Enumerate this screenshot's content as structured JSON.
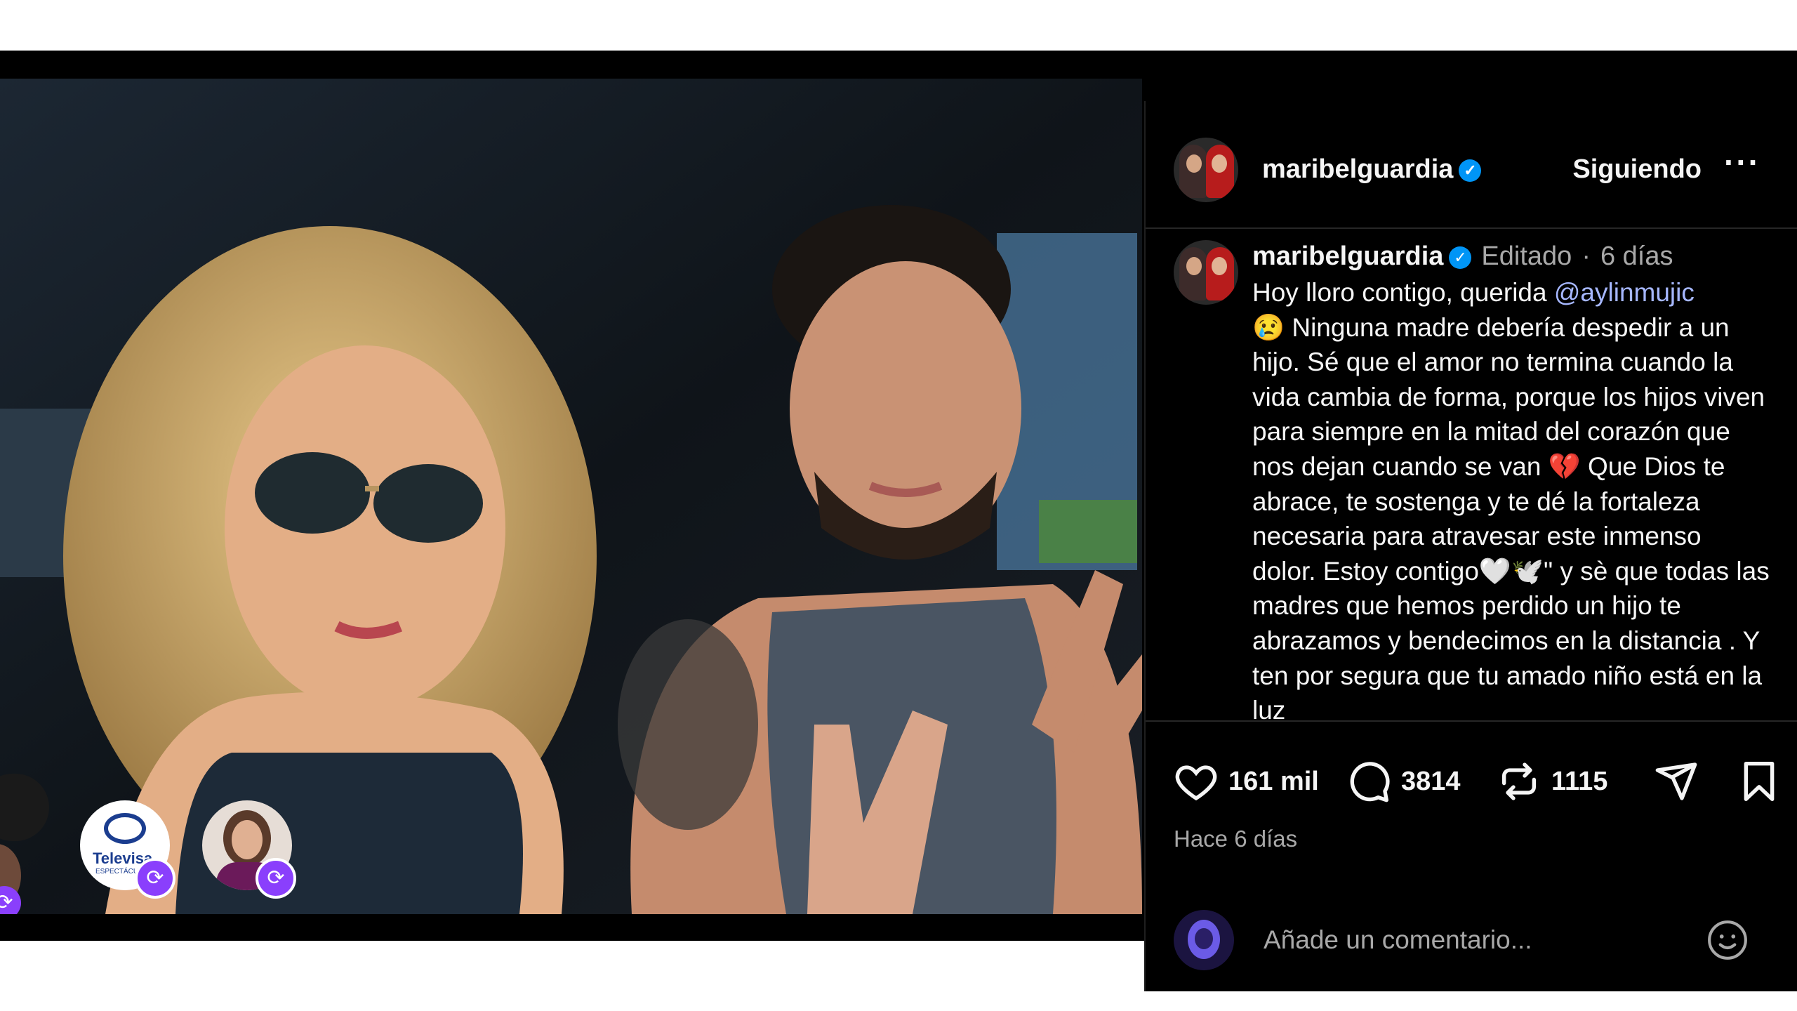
{
  "post": {
    "username": "maribelguardia",
    "verified_icon": "verified-badge-icon",
    "follow_label": "Siguiendo",
    "more_label": "···"
  },
  "caption": {
    "username": "maribelguardia",
    "edited": "Editado",
    "separator": "·",
    "age": "6 días",
    "text_before_mention": "Hoy lloro contigo, querida ",
    "mention": "@aylinmujic",
    "text_after_mention": "\n😢 Ninguna madre debería despedir a un hijo. Sé que el amor no termina cuando la vida cambia de forma, porque los hijos viven para siempre en la mitad del corazón que nos dejan cuando se van 💔 Que Dios te abrace, te sostenga y te dé la fortaleza necesaria para atravesar este inmenso dolor. Estoy contigo🤍🕊️\" y sè que todas las madres que hemos perdido un hijo te abrazamos y bendecimos en la distancia . Y ten por segura que tu amado niño está en la luz"
  },
  "actions": {
    "likes": "161 mil",
    "comments": "3814",
    "reposts": "1115",
    "timestamp": "Hace 6 días"
  },
  "comment_box": {
    "placeholder": "Añade un comentario..."
  },
  "overlay": {
    "story_logo_text": "Televisa",
    "story_logo_sub": "ESPECTÁCULOS"
  },
  "colors": {
    "background": "#000000",
    "text": "#f5f5f5",
    "muted": "#a8a8a8",
    "link": "#a6b7ff",
    "verified": "#0095f6",
    "repost_badge": "#8a3ffc"
  }
}
